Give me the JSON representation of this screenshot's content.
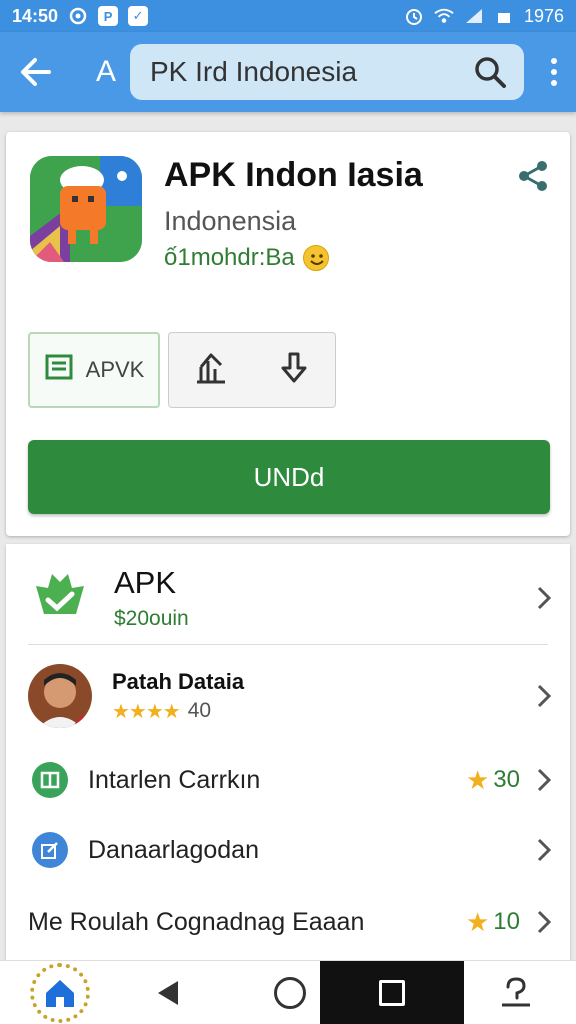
{
  "status_bar": {
    "time": "14:50",
    "battery_text": "1976"
  },
  "app_bar": {
    "a_label": "A",
    "search_value": "PK Ird Indonesia"
  },
  "app": {
    "title": "APK Indon Iasia",
    "subtitle": "Indonensia",
    "meta": "ố1mohdr:Ba",
    "apk_button": "APVK",
    "install_button": "UNDd"
  },
  "list": [
    {
      "title": "APK",
      "subtitle": "$20ouin"
    },
    {
      "title": "Patah Dataia",
      "rating_value": "40",
      "stars": "★★★★"
    },
    {
      "title": "Intarlen Carrkın",
      "rating": "30"
    },
    {
      "title": "Danaarlagodan"
    },
    {
      "title": "Me Roulah Cognadnag Eaaan",
      "rating": "10"
    }
  ],
  "colors": {
    "primary_blue": "#4a99e6",
    "install_green": "#2e8b3e",
    "star_gold": "#f2b01e"
  },
  "icons": [
    "back-arrow-icon",
    "search-icon",
    "more-vert-icon",
    "share-icon",
    "document-icon",
    "chart-icon",
    "download-icon",
    "chevron-right-icon",
    "home-icon",
    "nav-back-icon",
    "nav-home-circle-icon",
    "nav-recents-icon",
    "help-icon"
  ]
}
